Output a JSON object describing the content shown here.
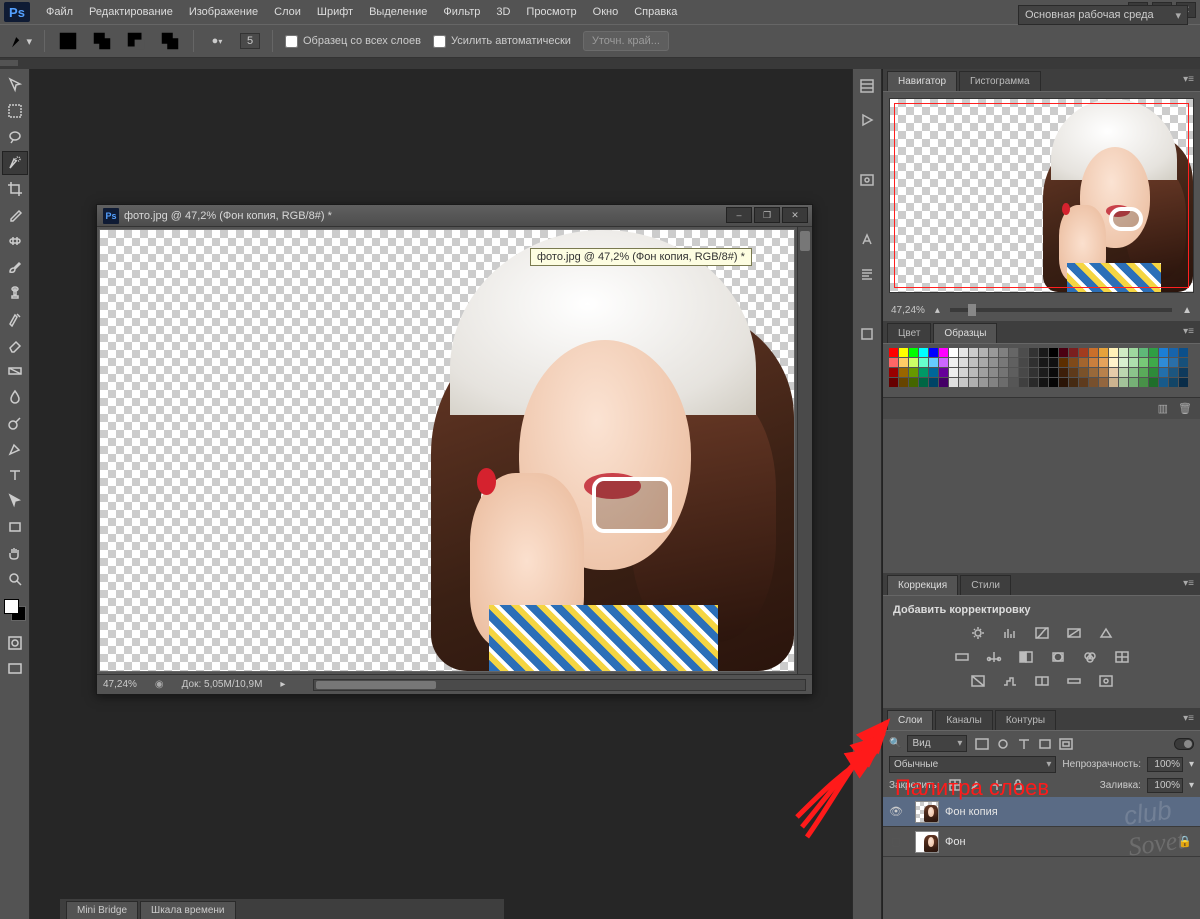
{
  "menu": {
    "items": [
      "Файл",
      "Редактирование",
      "Изображение",
      "Слои",
      "Шрифт",
      "Выделение",
      "Фильтр",
      "3D",
      "Просмотр",
      "Окно",
      "Справка"
    ]
  },
  "optbar": {
    "checkbox_all_layers": "Образец со всех слоев",
    "checkbox_auto_enhance": "Усилить автоматически",
    "btn_refine": "Уточн. край...",
    "brush_size": "5"
  },
  "workspace_selector": "Основная рабочая среда",
  "doc": {
    "title": "фото.jpg @ 47,2% (Фон копия, RGB/8#) *",
    "tooltip": "фото.jpg @ 47,2% (Фон копия, RGB/8#) *",
    "zoom_status": "47,24%",
    "doc_size": "Док: 5,05M/10,9M"
  },
  "navigator": {
    "tabs": [
      "Навигатор",
      "Гистограмма"
    ],
    "zoom": "47,24%"
  },
  "color_panel": {
    "tabs": [
      "Цвет",
      "Образцы"
    ]
  },
  "correction_panel": {
    "tabs": [
      "Коррекция",
      "Стили"
    ],
    "header": "Добавить корректировку"
  },
  "layers_panel": {
    "tabs": [
      "Слои",
      "Каналы",
      "Контуры"
    ],
    "kind_label": "Вид",
    "blend_mode": "Обычные",
    "opacity_label": "Непрозрачность:",
    "opacity_value": "100%",
    "lock_label": "Закрепить:",
    "fill_label": "Заливка:",
    "fill_value": "100%",
    "layers": [
      {
        "name": "Фон копия",
        "visible": true,
        "locked": false,
        "selected": true
      },
      {
        "name": "Фон",
        "visible": false,
        "locked": true,
        "selected": false
      }
    ]
  },
  "bottom_tabs": [
    "Mini Bridge",
    "Шкала времени"
  ],
  "annotation": "Палитра слоев",
  "swatch_colors": [
    "#ff0000",
    "#ffff00",
    "#00ff00",
    "#00ffff",
    "#0000ff",
    "#ff00ff",
    "#ffffff",
    "#e6e6e6",
    "#cccccc",
    "#b3b3b3",
    "#999999",
    "#808080",
    "#666666",
    "#4d4d4d",
    "#333333",
    "#1a1a1a",
    "#000000",
    "#4b0012",
    "#7a1f1f",
    "#a33c1f",
    "#c96f2b",
    "#e6a23c",
    "#fff1b8",
    "#d0ebc4",
    "#9fd89f",
    "#5fb878",
    "#2f9e44",
    "#1c7ed6",
    "#1864ab",
    "#0b4f8a",
    "#ff6666",
    "#ffcc66",
    "#ccff66",
    "#66ffcc",
    "#66ccff",
    "#cc66ff",
    "#f0f0f0",
    "#dcdcdc",
    "#c0c0c0",
    "#a9a9a9",
    "#909090",
    "#787878",
    "#606060",
    "#484848",
    "#303030",
    "#181818",
    "#101010",
    "#5c2e00",
    "#7f4a1a",
    "#a3652e",
    "#c97f3e",
    "#e6a35c",
    "#fff3cc",
    "#d8efcf",
    "#aee0ae",
    "#77c977",
    "#3fa94a",
    "#2f8bd6",
    "#2a6fa8",
    "#17507a",
    "#990000",
    "#996600",
    "#669900",
    "#009966",
    "#006699",
    "#660099",
    "#eeeeee",
    "#d4d4d4",
    "#bababa",
    "#a0a0a0",
    "#8a8a8a",
    "#747474",
    "#5e5e5e",
    "#484848",
    "#323232",
    "#1c1c1c",
    "#0a0a0a",
    "#3d1f0a",
    "#5e3a1a",
    "#7a522a",
    "#99693a",
    "#b8814c",
    "#e6ccaa",
    "#bcd6b0",
    "#8cc48c",
    "#5aaa5a",
    "#2e8b3a",
    "#236fab",
    "#1d567f",
    "#0f3a5c",
    "#660000",
    "#664400",
    "#446600",
    "#006644",
    "#004466",
    "#440066",
    "#e0e0e0",
    "#c8c8c8",
    "#b0b0b0",
    "#989898",
    "#828282",
    "#6c6c6c",
    "#565656",
    "#404040",
    "#2a2a2a",
    "#141414",
    "#050505",
    "#2a1406",
    "#452a12",
    "#5e3b1e",
    "#77502e",
    "#93663f",
    "#ccb38f",
    "#a3c299",
    "#76b076",
    "#489048",
    "#1f6e2a",
    "#185a8a",
    "#134566",
    "#092c48"
  ]
}
